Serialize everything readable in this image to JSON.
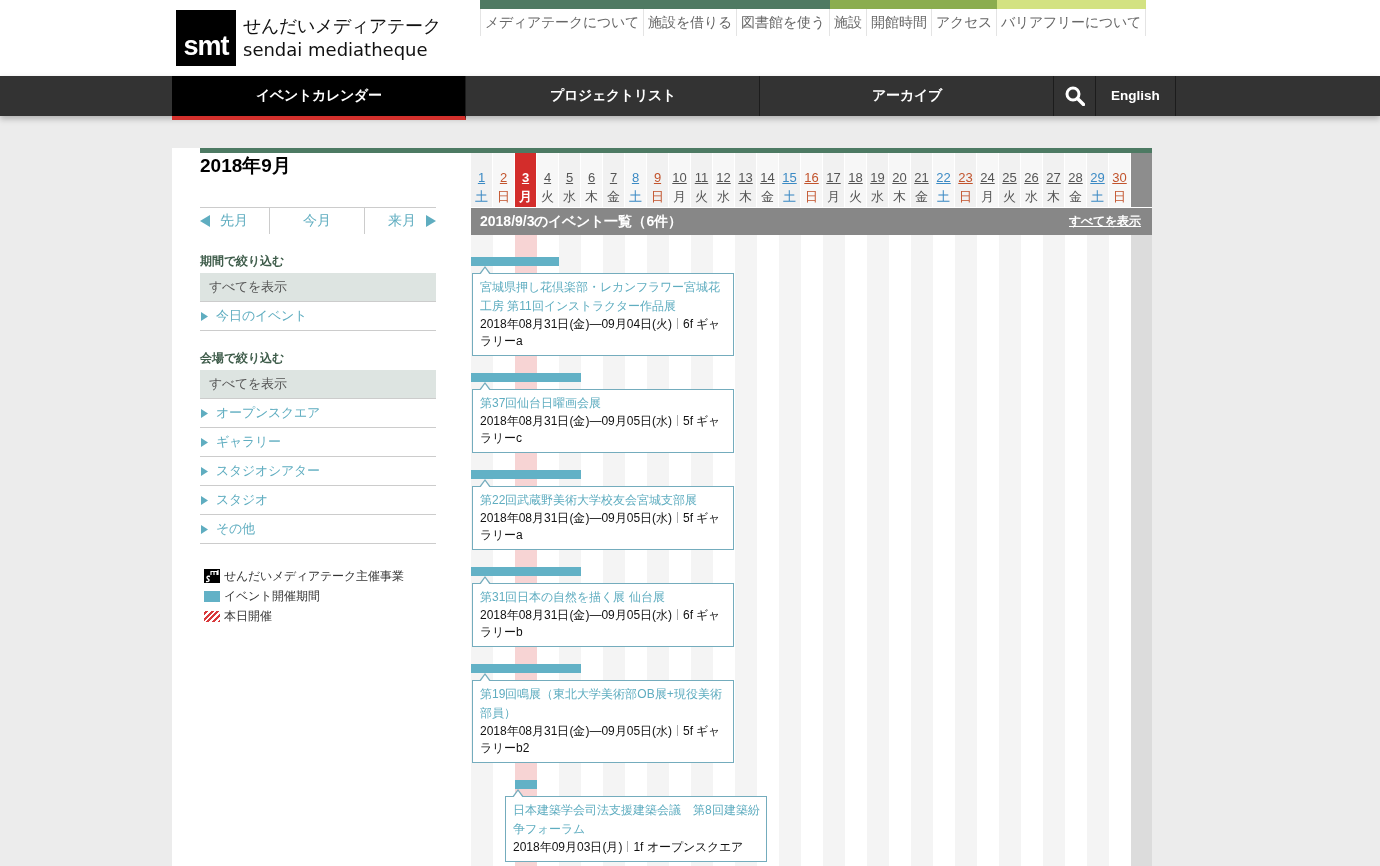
{
  "header": {
    "logo": {
      "mark": "smt",
      "name_ja": "せんだいメディアテーク",
      "name_en": "sendai mediatheque"
    },
    "top_link_groups": [
      {
        "color": "#4f7a63",
        "links": [
          "メディアテークについて",
          "施設を借りる",
          "図書館を使う"
        ]
      },
      {
        "color": "#8bad4f",
        "links": [
          "施設",
          "開館時間",
          "アクセス"
        ]
      },
      {
        "color": "#d3e282",
        "links": [
          "バリアフリーについて"
        ]
      }
    ]
  },
  "nav": {
    "tabs": [
      {
        "label": "イベントカレンダー",
        "selected": true
      },
      {
        "label": "プロジェクトリスト",
        "selected": false
      },
      {
        "label": "アーカイブ",
        "selected": false
      }
    ],
    "language": "English"
  },
  "sidebar": {
    "month_title": "2018年9月",
    "month_nav": {
      "previous": "先月",
      "current": "今月",
      "next": "来月"
    },
    "filters": [
      {
        "heading": "期間で絞り込む",
        "items": [
          {
            "label": "すべてを表示",
            "selected": true
          },
          {
            "label": "今日のイベント",
            "selected": false
          }
        ]
      },
      {
        "heading": "会場で絞り込む",
        "items": [
          {
            "label": "すべてを表示",
            "selected": true
          },
          {
            "label": "オープンスクエア",
            "selected": false
          },
          {
            "label": "ギャラリー",
            "selected": false
          },
          {
            "label": "スタジオシアター",
            "selected": false
          },
          {
            "label": "スタジオ",
            "selected": false
          },
          {
            "label": "その他",
            "selected": false
          }
        ]
      }
    ],
    "legend": [
      {
        "kind": "organizer",
        "label": "せんだいメディアテーク主催事業"
      },
      {
        "kind": "period",
        "label": "イベント開催期間"
      },
      {
        "kind": "today",
        "label": "本日開催"
      }
    ]
  },
  "calendar": {
    "days": [
      {
        "number": "1",
        "weekday": "土",
        "kind": "saturday",
        "selected": false
      },
      {
        "number": "2",
        "weekday": "日",
        "kind": "sunday",
        "selected": false
      },
      {
        "number": "3",
        "weekday": "月",
        "kind": "weekday",
        "selected": true
      },
      {
        "number": "4",
        "weekday": "火",
        "kind": "weekday",
        "selected": false
      },
      {
        "number": "5",
        "weekday": "水",
        "kind": "weekday",
        "selected": false
      },
      {
        "number": "6",
        "weekday": "木",
        "kind": "weekday",
        "selected": false
      },
      {
        "number": "7",
        "weekday": "金",
        "kind": "weekday",
        "selected": false
      },
      {
        "number": "8",
        "weekday": "土",
        "kind": "saturday",
        "selected": false
      },
      {
        "number": "9",
        "weekday": "日",
        "kind": "sunday",
        "selected": false
      },
      {
        "number": "10",
        "weekday": "月",
        "kind": "weekday",
        "selected": false
      },
      {
        "number": "11",
        "weekday": "火",
        "kind": "weekday",
        "selected": false
      },
      {
        "number": "12",
        "weekday": "水",
        "kind": "weekday",
        "selected": false
      },
      {
        "number": "13",
        "weekday": "木",
        "kind": "weekday",
        "selected": false
      },
      {
        "number": "14",
        "weekday": "金",
        "kind": "weekday",
        "selected": false
      },
      {
        "number": "15",
        "weekday": "土",
        "kind": "saturday",
        "selected": false
      },
      {
        "number": "16",
        "weekday": "日",
        "kind": "sunday",
        "selected": false
      },
      {
        "number": "17",
        "weekday": "月",
        "kind": "weekday",
        "selected": false
      },
      {
        "number": "18",
        "weekday": "火",
        "kind": "weekday",
        "selected": false
      },
      {
        "number": "19",
        "weekday": "水",
        "kind": "weekday",
        "selected": false
      },
      {
        "number": "20",
        "weekday": "木",
        "kind": "weekday",
        "selected": false
      },
      {
        "number": "21",
        "weekday": "金",
        "kind": "weekday",
        "selected": false
      },
      {
        "number": "22",
        "weekday": "土",
        "kind": "saturday",
        "selected": false
      },
      {
        "number": "23",
        "weekday": "日",
        "kind": "sunday",
        "selected": false
      },
      {
        "number": "24",
        "weekday": "月",
        "kind": "weekday",
        "selected": false
      },
      {
        "number": "25",
        "weekday": "火",
        "kind": "weekday",
        "selected": false
      },
      {
        "number": "26",
        "weekday": "水",
        "kind": "weekday",
        "selected": false
      },
      {
        "number": "27",
        "weekday": "木",
        "kind": "weekday",
        "selected": false
      },
      {
        "number": "28",
        "weekday": "金",
        "kind": "weekday",
        "selected": false
      },
      {
        "number": "29",
        "weekday": "土",
        "kind": "saturday",
        "selected": false
      },
      {
        "number": "30",
        "weekday": "日",
        "kind": "sunday",
        "selected": false
      }
    ],
    "list_heading": "2018/9/3のイベント一覧（6件）",
    "show_all": "すべてを表示",
    "events": [
      {
        "title": "宮城県押し花倶楽部・レカンフラワー宮城花工房 第11回インストラクター作品展",
        "period": "2018年08月31日(金)—09月04日(火)",
        "venue": "6f ギャラリーa"
      },
      {
        "title": "第37回仙台日曜画会展",
        "period": "2018年08月31日(金)—09月05日(水)",
        "venue": "5f ギャラリーc"
      },
      {
        "title": "第22回武蔵野美術大学校友会宮城支部展",
        "period": "2018年08月31日(金)—09月05日(水)",
        "venue": "5f ギャラリーa"
      },
      {
        "title": "第31回日本の自然を描く展 仙台展",
        "period": "2018年08月31日(金)—09月05日(水)",
        "venue": "6f ギャラリーb"
      },
      {
        "title": "第19回鳴展（東北大学美術部OB展+現役美術部員）",
        "period": "2018年08月31日(金)—09月05日(水)",
        "venue": "5f ギャラリーb2"
      },
      {
        "title": "日本建築学会司法支援建築会議　第8回建築紛争フォーラム",
        "period": "2018年09月03日(月)",
        "venue": "1f オープンスクエア"
      }
    ]
  }
}
